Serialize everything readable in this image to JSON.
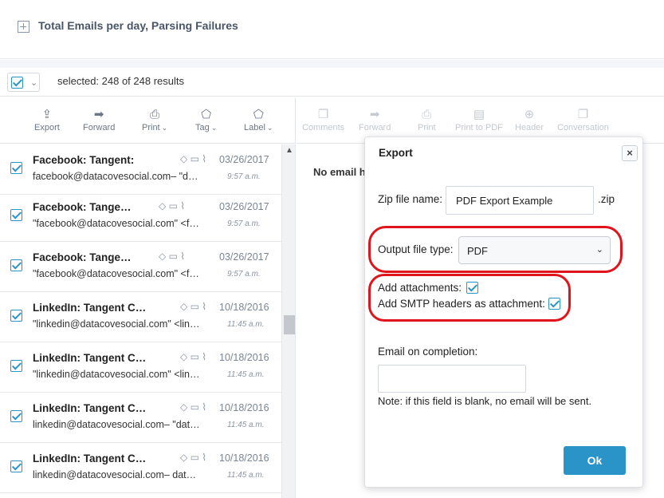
{
  "report": {
    "title": "Total Emails per day, Parsing Failures",
    "icon": "expand-plus-icon"
  },
  "selection": {
    "text": "selected: 248 of 248 results"
  },
  "left_toolbar": [
    {
      "label": "Export",
      "icon": "export-icon",
      "glyph": "⇪"
    },
    {
      "label": "Forward",
      "icon": "forward-icon",
      "glyph": "➡"
    },
    {
      "label": "Print",
      "icon": "print-icon",
      "glyph": "⎙"
    },
    {
      "label": "Tag",
      "icon": "tag-icon",
      "glyph": "⬠"
    },
    {
      "label": "Label",
      "icon": "label-icon",
      "glyph": "⬠"
    }
  ],
  "right_toolbar": [
    {
      "label": "Comments",
      "icon": "comments-icon",
      "glyph": "❐"
    },
    {
      "label": "Forward",
      "icon": "forward-icon",
      "glyph": "➡"
    },
    {
      "label": "Print",
      "icon": "print-icon",
      "glyph": "⎙"
    },
    {
      "label": "Print to PDF",
      "icon": "pdf-icon",
      "glyph": "▤"
    },
    {
      "label": "Header",
      "icon": "header-zoom-icon",
      "glyph": "⊕"
    },
    {
      "label": "Conversation",
      "icon": "conversation-icon",
      "glyph": "❐"
    }
  ],
  "emails": [
    {
      "sender": "Facebook: Tangent:",
      "from": "facebook@datacovesocial.com– \"d…",
      "date": "03/26/2017",
      "time": "9:57 a.m."
    },
    {
      "sender": "Facebook: Tange…",
      "from": "\"facebook@datacovesocial.com\" <f…",
      "date": "03/26/2017",
      "time": "9:57 a.m."
    },
    {
      "sender": "Facebook: Tange…",
      "from": "\"facebook@datacovesocial.com\" <f…",
      "date": "03/26/2017",
      "time": "9:57 a.m."
    },
    {
      "sender": "LinkedIn: Tangent C…",
      "from": "\"linkedin@datacovesocial.com\" <lin…",
      "date": "10/18/2016",
      "time": "11:45 a.m."
    },
    {
      "sender": "LinkedIn: Tangent C…",
      "from": "\"linkedin@datacovesocial.com\" <lin…",
      "date": "10/18/2016",
      "time": "11:45 a.m."
    },
    {
      "sender": "LinkedIn: Tangent C…",
      "from": "linkedin@datacovesocial.com– \"dat…",
      "date": "10/18/2016",
      "time": "11:45 a.m."
    },
    {
      "sender": "LinkedIn: Tangent C…",
      "from": "linkedin@datacovesocial.com– dat…",
      "date": "10/18/2016",
      "time": "11:45 a.m."
    }
  ],
  "email_row_icons": "◇ ▭ ⌇",
  "preview": {
    "no_email_text": "No email h"
  },
  "export_dialog": {
    "title": "Export",
    "close_label": "×",
    "zip_label": "Zip file name:",
    "zip_value": "PDF Export Example",
    "zip_suffix": ".zip",
    "output_label": "Output file type:",
    "output_value": "PDF",
    "attachments_label": "Add attachments:",
    "smtp_label": "Add SMTP headers as attachment:",
    "email_label": "Email on completion:",
    "note": "Note: if this field is blank, no email will be sent.",
    "ok_label": "Ok"
  },
  "colors": {
    "accent": "#2a93c8",
    "highlight": "#e0141c"
  }
}
